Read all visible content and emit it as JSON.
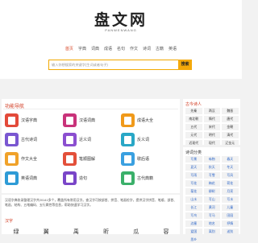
{
  "header": {
    "logo": "盘文网",
    "logo_sub": "PANWENWANG",
    "nav": [
      "首页",
      "字典",
      "词典",
      "成语",
      "名句",
      "作文",
      "诗词",
      "古籍",
      "英语"
    ],
    "search_placeholder": "输入你想搜索的关键字(生词或者句子)",
    "search_button": "搜索"
  },
  "main": {
    "section_title": "功能导航",
    "items": [
      {
        "label": "汉语字典",
        "color": "#e34a3a"
      },
      {
        "label": "汉语词典",
        "color": "#c9337a"
      },
      {
        "label": "成语大全",
        "color": "#f09a1a"
      },
      {
        "label": "古代诗词",
        "color": "#7a57d1"
      },
      {
        "label": "近义词",
        "color": "#8b4fd0"
      },
      {
        "label": "反义词",
        "color": "#29a7c6"
      },
      {
        "label": "作文大全",
        "color": "#f0a22a"
      },
      {
        "label": "笔顺图解",
        "color": "#e3503a"
      },
      {
        "label": "歇后语",
        "color": "#3aa0e0"
      },
      {
        "label": "英语词典",
        "color": "#2e9bd6"
      },
      {
        "label": "造句",
        "color": "#7a46c8"
      },
      {
        "label": "古代典籍",
        "color": "#3bb06a"
      }
    ]
  },
  "description": {
    "text": "汉语字典收录整理汉字共20141多个，覆盖所有常用汉字。查汉字可按部首、拼音、笔画检字，提供汉字拼音、笔顺、部首、笔画、结构、五笔编码、五行属性等信息，帮助快速学习汉字。",
    "hanzi_title": "汉字",
    "hanzi": [
      {
        "pinyin": "",
        "char": "绿"
      },
      {
        "pinyin": "",
        "char": "翼"
      },
      {
        "pinyin": "",
        "char": "禹"
      },
      {
        "pinyin": "",
        "char": "昕"
      },
      {
        "pinyin": "",
        "char": "瓜"
      },
      {
        "pinyin": "",
        "char": "容"
      }
    ]
  },
  "sidebar": {
    "poets_title": "古今诗人",
    "poets": [
      "先秦",
      "两汉",
      "魏晋",
      "南北朝",
      "隋代",
      "唐代",
      "五代",
      "宋代",
      "金朝",
      "元代",
      "明代",
      "清代",
      "近现代",
      "现代",
      "辽金元"
    ],
    "categories_title": "诗词分类",
    "categories": [
      "写景",
      "咏物",
      "春天",
      "夏天",
      "秋天",
      "冬天",
      "写雨",
      "写雪",
      "写风",
      "写花",
      "梅花",
      "荷花",
      "菊花",
      "柳树",
      "月亮",
      "山水",
      "写山",
      "写水",
      "长江",
      "黄河",
      "儿童",
      "写鸟",
      "写马",
      "田园",
      "边塞",
      "地名",
      "抒情",
      "爱国",
      "离别",
      "送别",
      "思乡"
    ]
  },
  "colors": {
    "accent": "#d0381e",
    "search": "#f4a90a",
    "link": "#2a64c8"
  }
}
